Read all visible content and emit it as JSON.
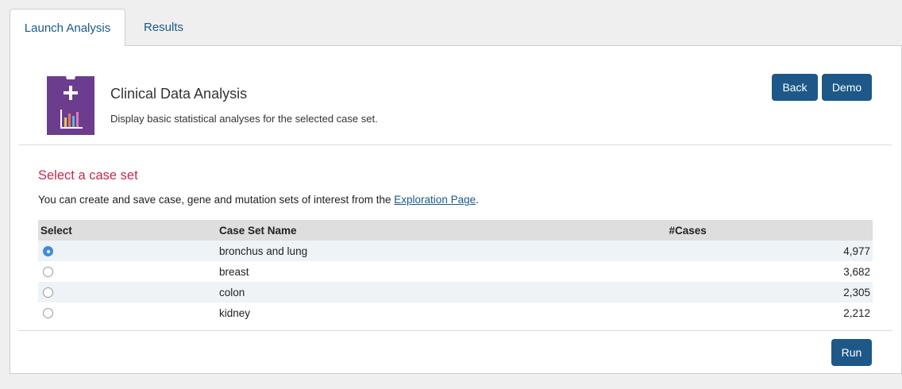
{
  "tabs": [
    {
      "label": "Launch Analysis",
      "active": true
    },
    {
      "label": "Results",
      "active": false
    }
  ],
  "app": {
    "title": "Clinical Data Analysis",
    "description": "Display basic statistical analyses for the selected case set.",
    "icon": "clipboard-chart-icon",
    "icon_color": "#6c3d8f"
  },
  "buttons": {
    "back": "Back",
    "demo": "Demo",
    "run": "Run"
  },
  "case_set": {
    "title": "Select a case set",
    "helper_prefix": "You can create and save case, gene and mutation sets of interest from the ",
    "helper_link": "Exploration Page",
    "helper_suffix": "."
  },
  "table": {
    "headers": {
      "select": "Select",
      "name": "Case Set Name",
      "cases": "#Cases"
    },
    "rows": [
      {
        "name": "bronchus and lung",
        "cases": "4,977",
        "selected": true
      },
      {
        "name": "breast",
        "cases": "3,682",
        "selected": false
      },
      {
        "name": "colon",
        "cases": "2,305",
        "selected": false
      },
      {
        "name": "kidney",
        "cases": "2,212",
        "selected": false
      }
    ]
  },
  "colors": {
    "primary_button": "#1d5888",
    "section_title": "#c8284c",
    "radio_selected": "#3d8be3",
    "row_stripe": "#edf3f7",
    "header_bg": "#dedede"
  }
}
